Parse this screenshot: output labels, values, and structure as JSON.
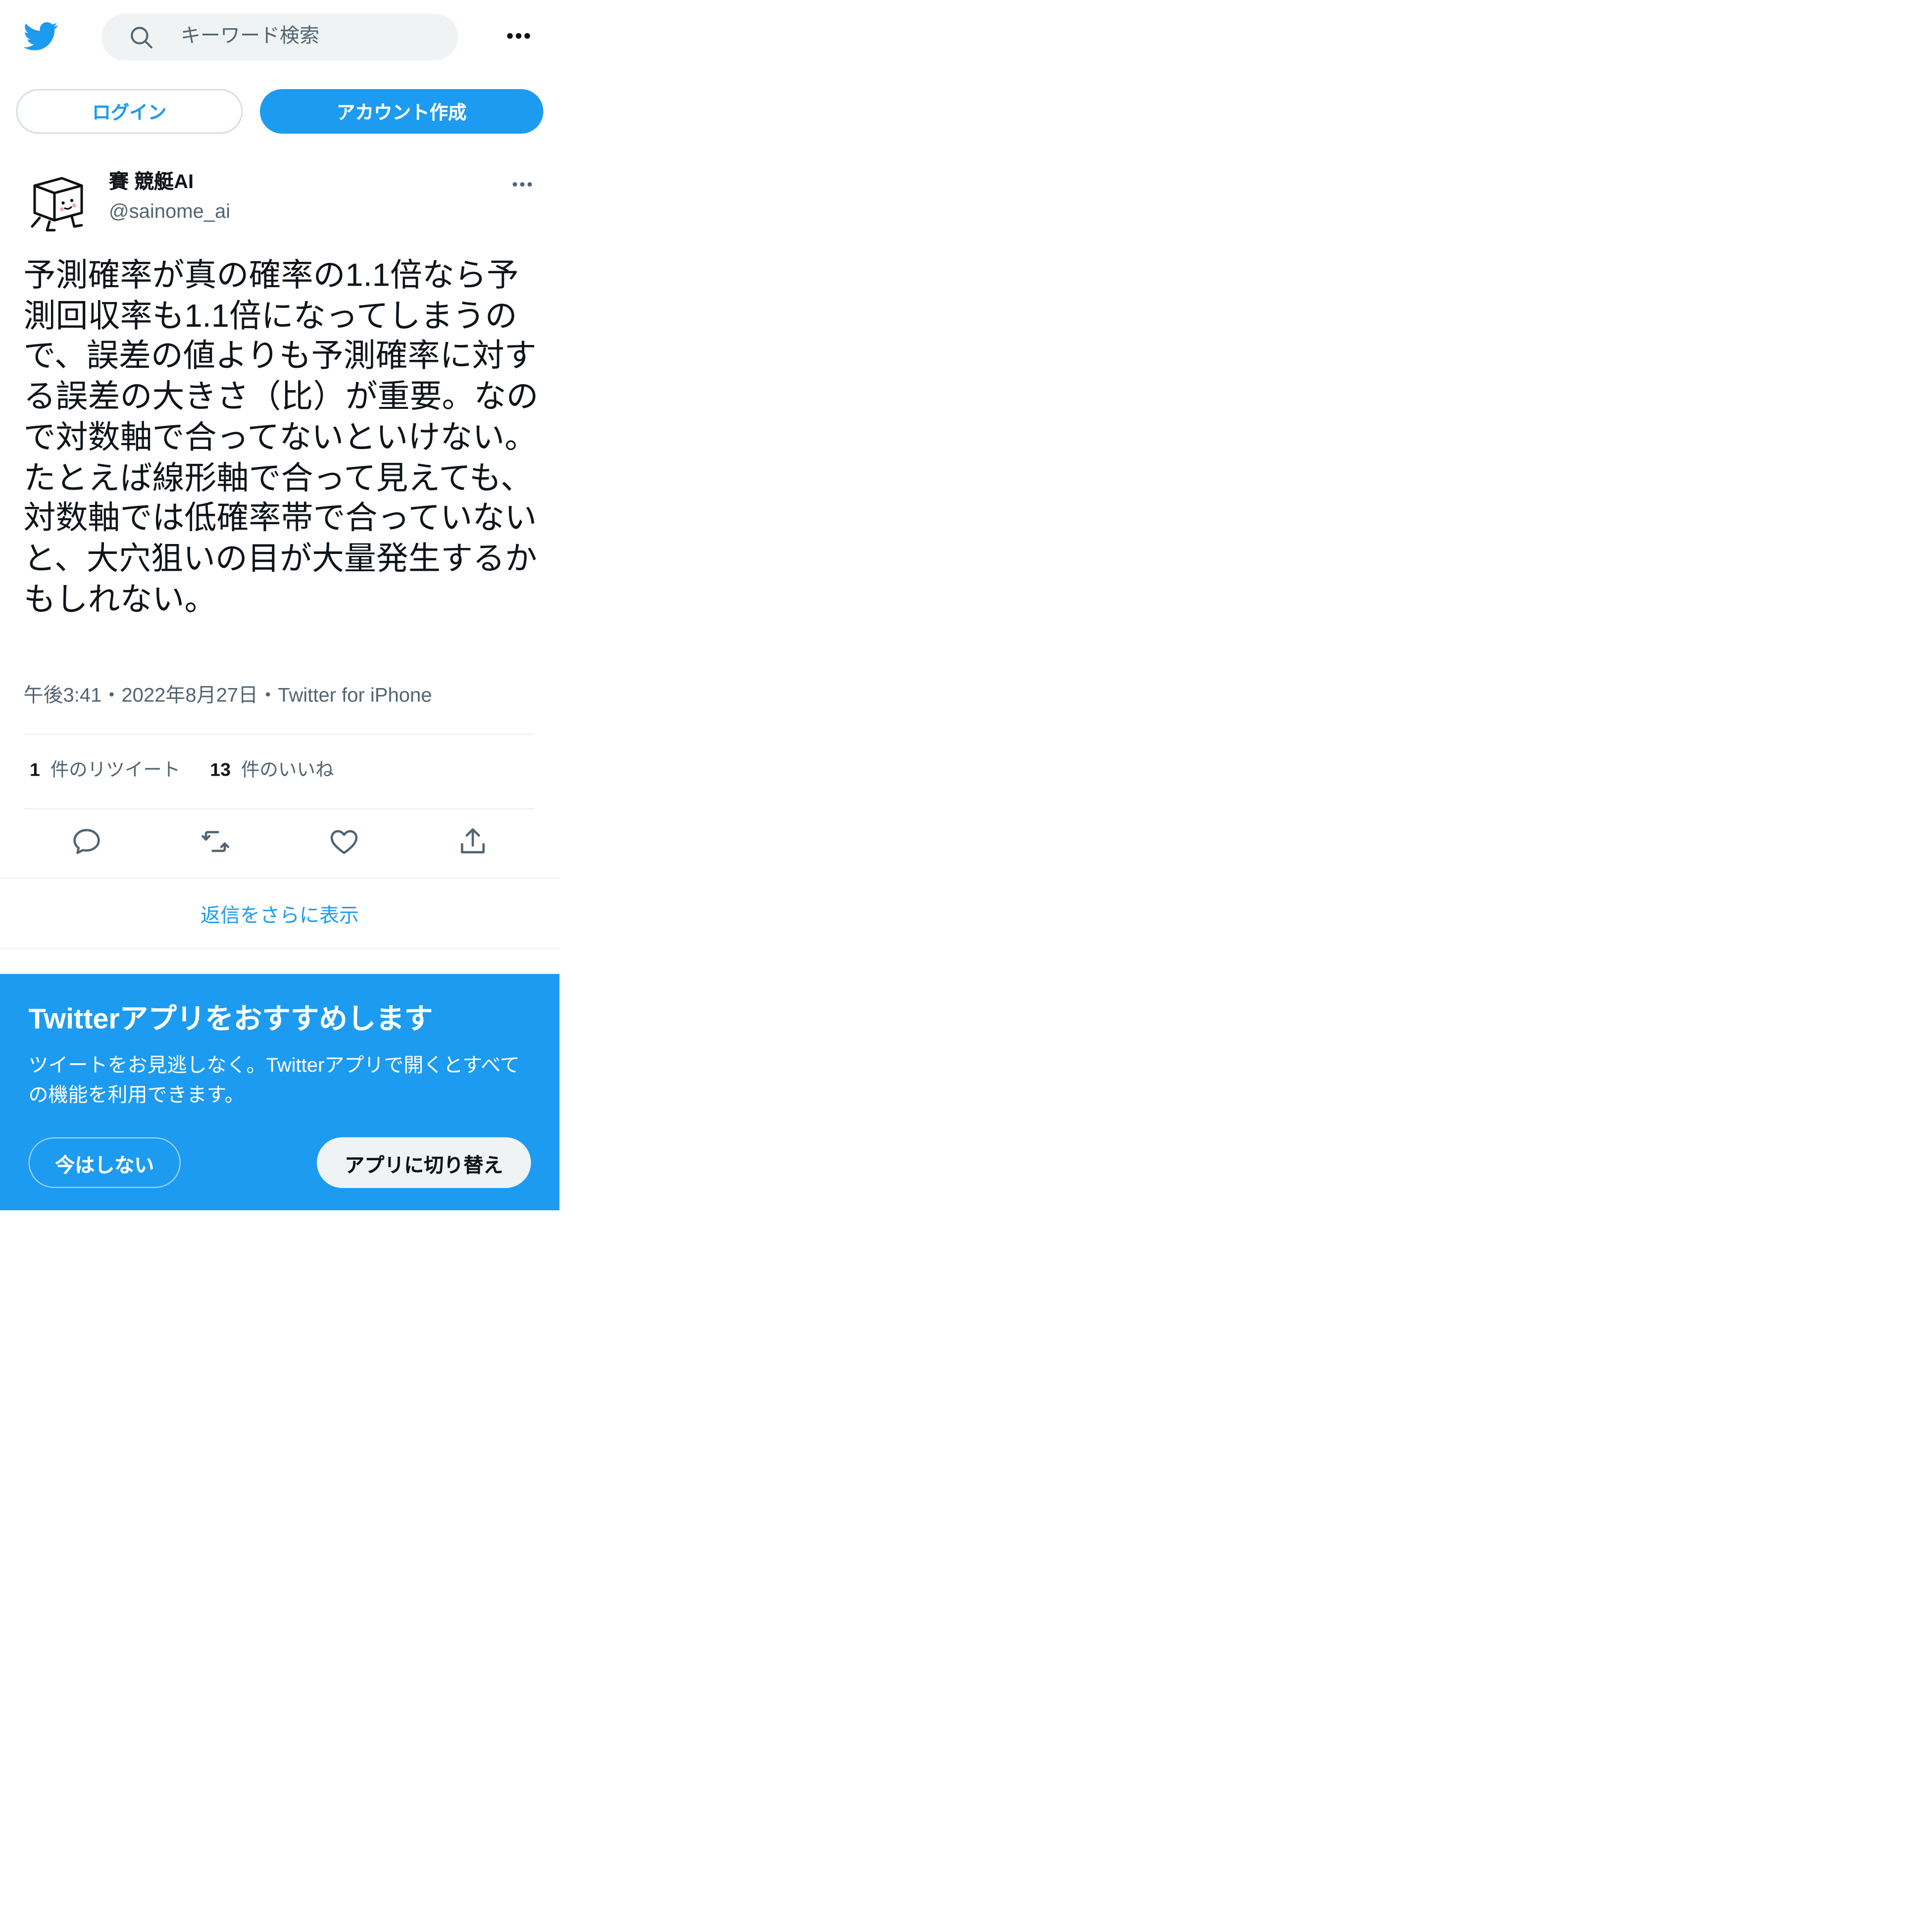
{
  "header": {
    "logo_icon": "twitter-bird-icon",
    "search_placeholder": "キーワード検索",
    "more_icon": "more-horizontal-icon"
  },
  "auth": {
    "login_label": "ログイン",
    "signup_label": "アカウント作成"
  },
  "tweet": {
    "display_name": "賽 競艇AI",
    "handle": "@sainome_ai",
    "text": "予測確率が真の確率の1.1倍なら予測回収率も1.1倍になってしまうので、誤差の値よりも予測確率に対する誤差の大きさ（比）が重要。なので対数軸で合ってないといけない。\nたとえば線形軸で合って見えても、対数軸では低確率帯で合っていないと、大穴狙いの目が大量発生するかもしれない。",
    "time": "午後3:41",
    "date": "2022年8月27日",
    "source": "Twitter for iPhone",
    "separator": "・",
    "retweet_count": "1",
    "retweet_label": "件のリツイート",
    "like_count": "13",
    "like_label": "件のいいね",
    "actions": [
      "reply-icon",
      "retweet-icon",
      "like-icon",
      "share-icon"
    ]
  },
  "more_replies_label": "返信をさらに表示",
  "promo": {
    "title": "Twitterアプリをおすすめします",
    "description": "ツイートをお見逃しなく。Twitterアプリで開くとすべての機能を利用できます。",
    "not_now_label": "今はしない",
    "switch_label": "アプリに切り替え"
  },
  "colors": {
    "accent": "#1d9bf0",
    "text": "#0f1419",
    "secondary_text": "#536471",
    "search_bg": "#eff3f4"
  }
}
